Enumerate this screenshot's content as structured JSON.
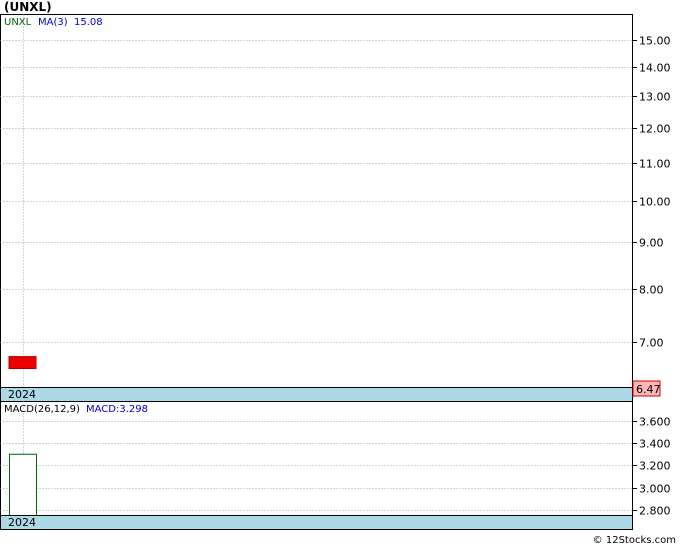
{
  "title": "(UNXL)",
  "copyright": "© 12Stocks.com",
  "colors": {
    "grid": "#aaaaaa",
    "axis_band": "#add8e6",
    "candle_down": "#ee0000",
    "macd_bar_stroke": "#006600",
    "last_price_box": "#ffb6b6",
    "ticker_legend": "#006600",
    "ma_legend": "#0000cc"
  },
  "chart_data": [
    {
      "type": "candlestick",
      "name": "price",
      "legend": {
        "ticker": "UNXL",
        "ma_label": "MA(3)",
        "ma_value": "15.08"
      },
      "y_scale": "log",
      "ylim": [
        6.3,
        15.6
      ],
      "y_ticks": [
        {
          "value": 15,
          "label": "15.00"
        },
        {
          "value": 14,
          "label": "14.00"
        },
        {
          "value": 13,
          "label": "13.00"
        },
        {
          "value": 12,
          "label": "12.00"
        },
        {
          "value": 11,
          "label": "11.00"
        },
        {
          "value": 10,
          "label": "10.00"
        },
        {
          "value": 9,
          "label": "9.00"
        },
        {
          "value": 8,
          "label": "8.00"
        },
        {
          "value": 7,
          "label": "7.00"
        }
      ],
      "candles": [
        {
          "open": 6.75,
          "close": 6.55,
          "high": 6.75,
          "low": 6.55
        }
      ],
      "last_price": {
        "value": 6.47,
        "label": "6.47"
      },
      "x_label": "2024"
    },
    {
      "type": "bar",
      "name": "macd",
      "legend": {
        "label": "MACD(26,12,9)",
        "value_label": "MACD:3.298"
      },
      "ylim": [
        2.75,
        3.77
      ],
      "y_ticks": [
        {
          "value": 3.6,
          "label": "3.600"
        },
        {
          "value": 3.4,
          "label": "3.400"
        },
        {
          "value": 3.2,
          "label": "3.200"
        },
        {
          "value": 3.0,
          "label": "3.000"
        },
        {
          "value": 2.8,
          "label": "2.800"
        }
      ],
      "values": [
        3.298
      ],
      "x_label": "2024"
    }
  ]
}
